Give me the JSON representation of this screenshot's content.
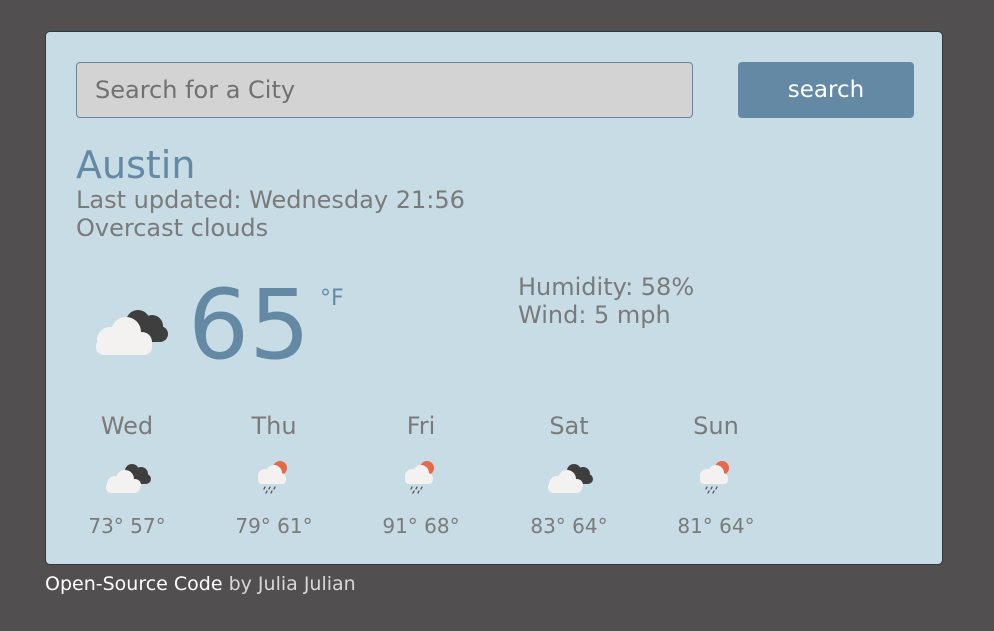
{
  "search": {
    "placeholder": "Search for a City",
    "button_label": "search"
  },
  "current": {
    "city": "Austin",
    "last_updated": "Last updated: Wednesday 21:56",
    "description": "Overcast clouds",
    "temperature": "65",
    "unit": "°F",
    "humidity": "Humidity: 58%",
    "wind": "Wind: 5 mph",
    "icon": "overcast-clouds-icon"
  },
  "forecast": [
    {
      "day": "Wed",
      "high": "73°",
      "low": "57°",
      "icon": "overcast-clouds-icon"
    },
    {
      "day": "Thu",
      "high": "79°",
      "low": "61°",
      "icon": "sun-rain-icon"
    },
    {
      "day": "Fri",
      "high": "91°",
      "low": "68°",
      "icon": "sun-rain-icon"
    },
    {
      "day": "Sat",
      "high": "83°",
      "low": "64°",
      "icon": "overcast-clouds-icon"
    },
    {
      "day": "Sun",
      "high": "81°",
      "low": "64°",
      "icon": "sun-rain-icon"
    }
  ],
  "footer": {
    "link_text": "Open-Source Code",
    "byline": " by Julia Julian"
  },
  "colors": {
    "background": "#514f50",
    "card": "#c8dce5",
    "accent": "#6389a4",
    "text": "#7a7a7a",
    "sun": "#e8694a"
  }
}
